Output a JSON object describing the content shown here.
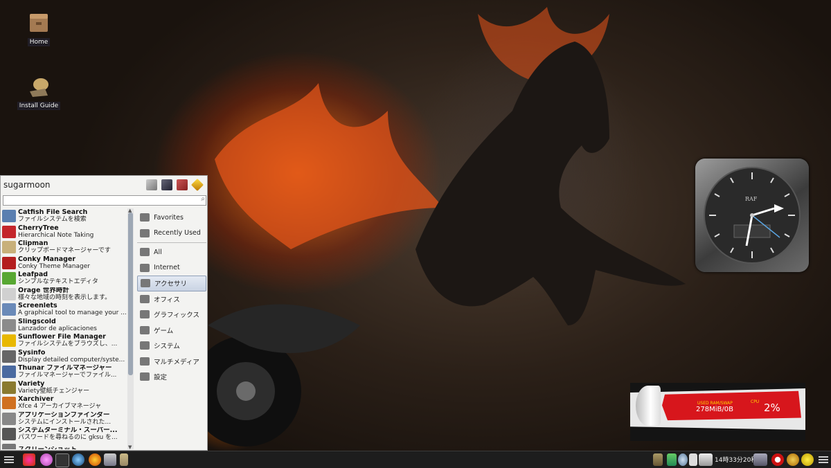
{
  "desktop": {
    "icons": [
      {
        "label": "Home"
      },
      {
        "label": "Install Guide"
      }
    ]
  },
  "menu": {
    "username": "sugarmoon",
    "search_placeholder": "",
    "apps": [
      {
        "name": "Catfish File Search",
        "desc": "ファイルシステムを検索"
      },
      {
        "name": "CherryTree",
        "desc": "Hierarchical Note Taking"
      },
      {
        "name": "Clipman",
        "desc": "クリップボードマネージャーです"
      },
      {
        "name": "Conky Manager",
        "desc": "Conky Theme Manager"
      },
      {
        "name": "Leafpad",
        "desc": "シンプルなテキストエディタ"
      },
      {
        "name": "Orage 世界時計",
        "desc": "様々な地域の時刻を表示します。"
      },
      {
        "name": "Screenlets",
        "desc": "A graphical tool to manage your ..."
      },
      {
        "name": "Slingscold",
        "desc": "Lanzador de aplicaciones"
      },
      {
        "name": "Sunflower File Manager",
        "desc": "ファイルシステムをブラウズし、..."
      },
      {
        "name": "Sysinfo",
        "desc": "Display detailed computer/syste..."
      },
      {
        "name": "Thunar ファイルマネージャー",
        "desc": "ファイルマネージャーでファイル..."
      },
      {
        "name": "Variety",
        "desc": "Variety壁紙チェンジャー"
      },
      {
        "name": "Xarchiver",
        "desc": "Xfce 4 アーカイブマネージャ"
      },
      {
        "name": "アプリケーションファインダー",
        "desc": "システムにインストールされた..."
      },
      {
        "name": "システムターミナル・スーパー...",
        "desc": "パスワードを尋ねるのに gksu を..."
      },
      {
        "name": "スクリーンショット",
        "desc": ""
      }
    ],
    "categories_top": [
      "Favorites",
      "Recently Used"
    ],
    "categories": [
      "All",
      "Internet",
      "アクセサリ",
      "オフィス",
      "グラフィックス",
      "ゲーム",
      "システム",
      "マルチメディア",
      "設定"
    ],
    "selected_category": "アクセサリ"
  },
  "widgets": {
    "clock_brand": "RAF",
    "sysmon": {
      "ram_label": "USED RAM/SWAP",
      "ram_value": "278MiB/0B",
      "cpu_label": "CPU",
      "cpu_value": "2%"
    }
  },
  "taskbar": {
    "clock": "14時33分20秒"
  },
  "colors": {
    "menu_bg": "#f3f3f1",
    "selection": "#c9d3e3",
    "taskbar": "#1d1d1d",
    "sysmon_red": "#d7161c"
  }
}
